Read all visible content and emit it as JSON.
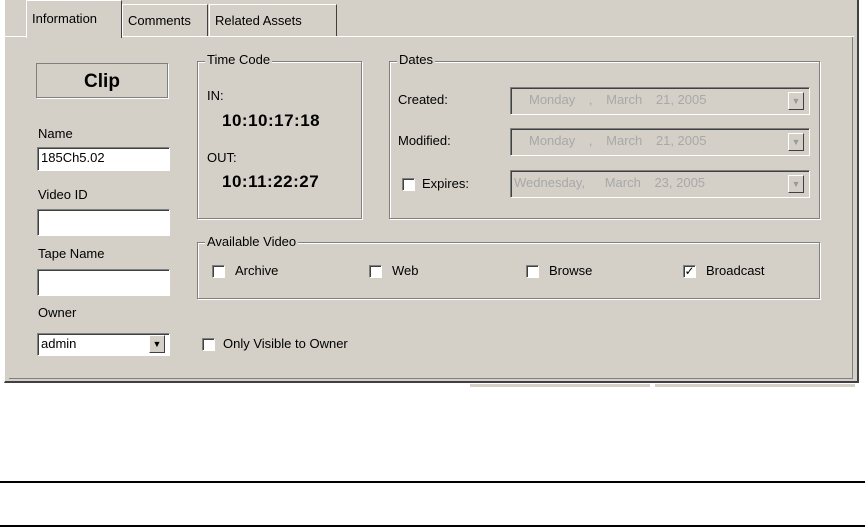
{
  "tabs": [
    {
      "label": "Information",
      "active": true
    },
    {
      "label": "Comments",
      "active": false
    },
    {
      "label": "Related Assets",
      "active": false
    }
  ],
  "clip_label": "Clip",
  "name": {
    "label": "Name",
    "value": "185Ch5.02"
  },
  "video_id": {
    "label": "Video ID",
    "value": ""
  },
  "tape_name": {
    "label": "Tape Name",
    "value": ""
  },
  "owner": {
    "label": "Owner",
    "value": "admin"
  },
  "only_visible": {
    "label": "Only Visible to Owner",
    "checked": false
  },
  "time_code": {
    "title": "Time Code",
    "in_label": "IN:",
    "in_value": "10:10:17:18",
    "out_label": "OUT:",
    "out_value": "10:11:22:27"
  },
  "dates": {
    "title": "Dates",
    "created": {
      "label": "Created:",
      "day": "Monday",
      "sep": ",",
      "month": "March",
      "date": "21, 2005"
    },
    "modified": {
      "label": "Modified:",
      "day": "Monday",
      "sep": ",",
      "month": "March",
      "date": "21, 2005"
    },
    "expires": {
      "label": "Expires:",
      "checked": false,
      "day": "Wednesday,",
      "month": "March",
      "date": "23, 2005"
    }
  },
  "available_video": {
    "title": "Available Video",
    "options": [
      {
        "label": "Archive",
        "checked": false
      },
      {
        "label": "Web",
        "checked": false
      },
      {
        "label": "Browse",
        "checked": false
      },
      {
        "label": "Broadcast",
        "checked": true
      }
    ]
  },
  "icons": {
    "dropdown": "chevron-down-icon",
    "check": "check-icon"
  }
}
